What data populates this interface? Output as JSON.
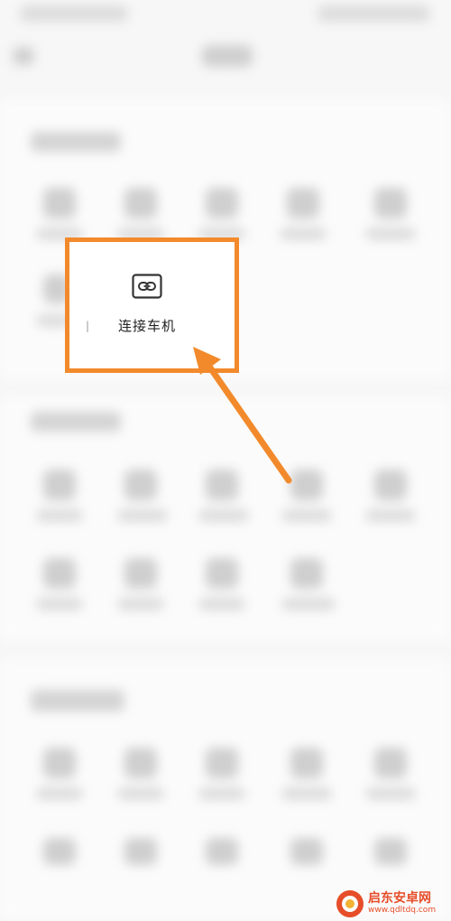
{
  "focus_item": {
    "label": "连接车机",
    "icon": "link-icon"
  },
  "annotation": {
    "highlight_color": "#f28a2c",
    "arrow_color": "#f28a2c"
  },
  "watermark": {
    "brand": "启东安卓网",
    "url": "www.qdltdq.com",
    "color": "#e64d29"
  }
}
